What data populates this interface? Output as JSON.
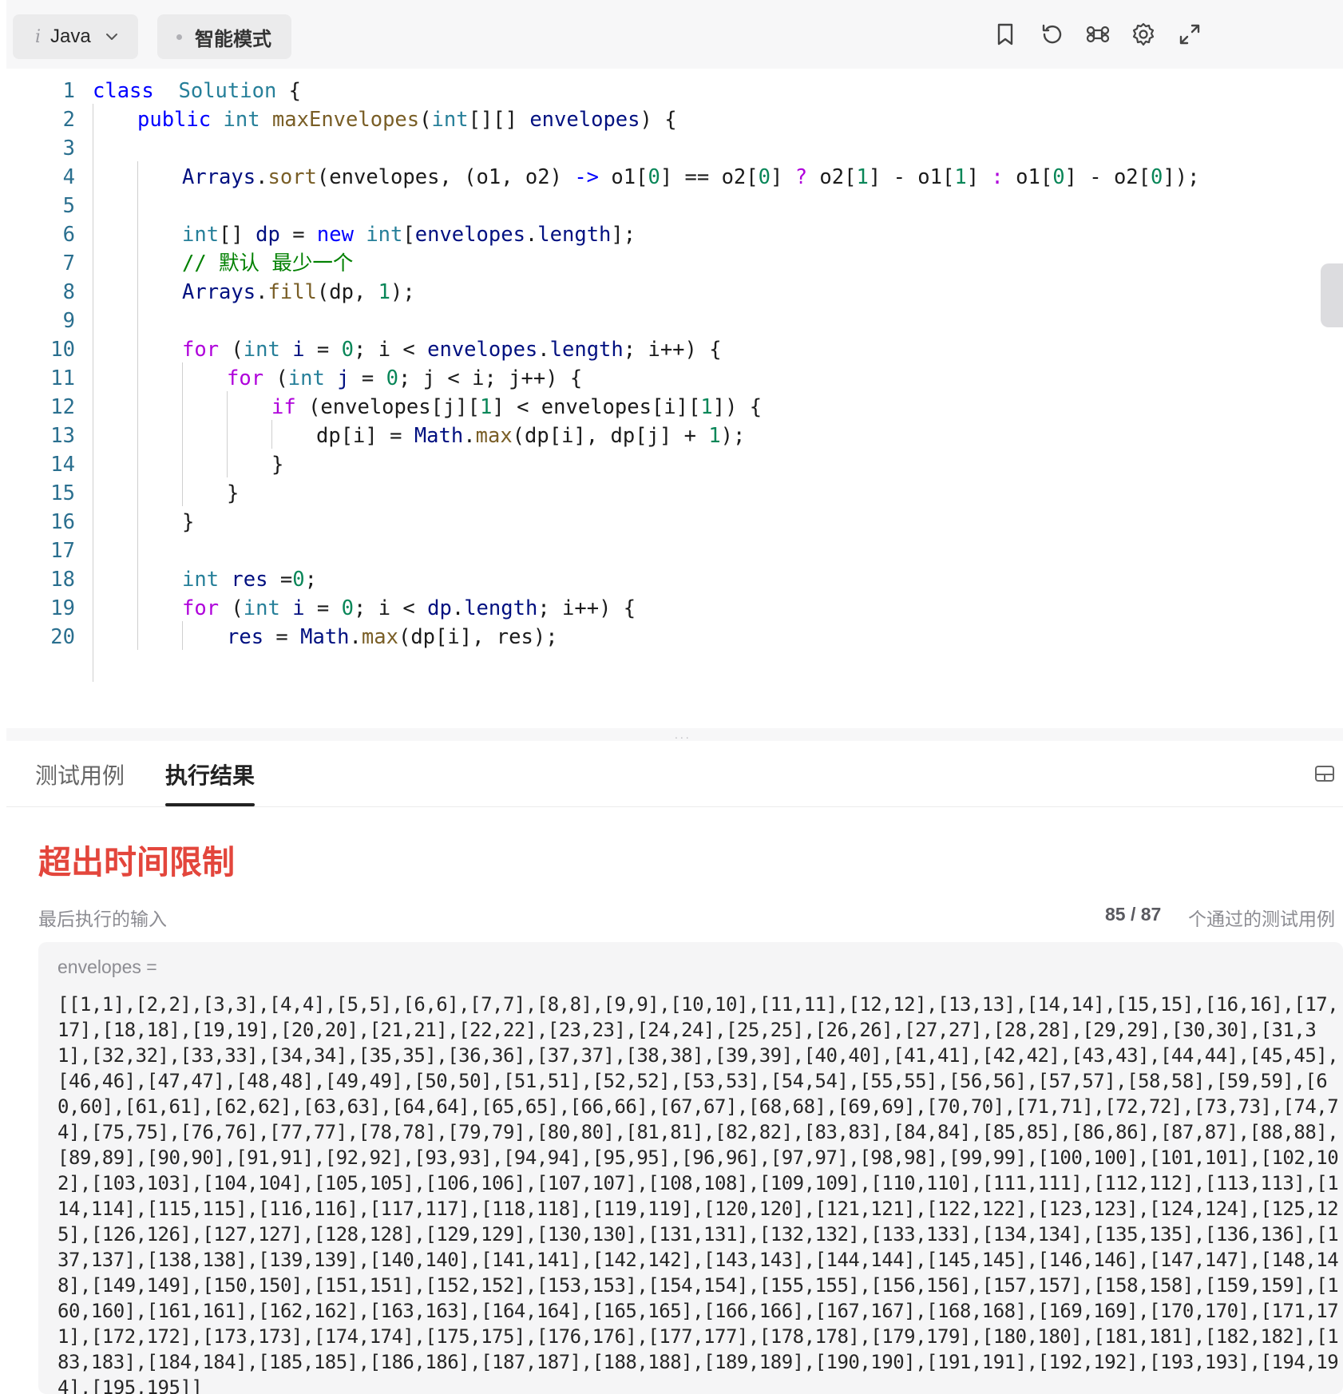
{
  "toolbar": {
    "language_icon": "i",
    "language": "Java",
    "mode_label": "智能模式",
    "icons": [
      "bookmark-icon",
      "reset-icon",
      "command-icon",
      "settings-icon",
      "fullscreen-icon"
    ]
  },
  "editor": {
    "lines": [
      {
        "n": "1",
        "indent": 0,
        "tokens": [
          [
            "kw",
            "class"
          ],
          [
            "",
            "  "
          ],
          [
            "ty",
            "Solution"
          ],
          [
            "",
            " {"
          ]
        ]
      },
      {
        "n": "2",
        "indent": 1,
        "tokens": [
          [
            "kw",
            "public"
          ],
          [
            "",
            " "
          ],
          [
            "ty",
            "int"
          ],
          [
            "",
            " "
          ],
          [
            "fn",
            "maxEnvelopes"
          ],
          [
            "",
            "("
          ],
          [
            "ty",
            "int"
          ],
          [
            "",
            "[][] "
          ],
          [
            "var",
            "envelopes"
          ],
          [
            "",
            ") {"
          ]
        ]
      },
      {
        "n": "3",
        "indent": 1,
        "tokens": []
      },
      {
        "n": "4",
        "indent": 2,
        "tokens": [
          [
            "var",
            "Arrays"
          ],
          [
            "",
            "."
          ],
          [
            "fn",
            "sort"
          ],
          [
            "",
            "("
          ],
          [
            "",
            "envelopes, (o1, o2) "
          ],
          [
            "kw",
            "->"
          ],
          [
            "",
            " o1["
          ],
          [
            "num",
            "0"
          ],
          [
            "",
            "] == o2["
          ],
          [
            "num",
            "0"
          ],
          [
            "",
            "] "
          ],
          [
            "kw2",
            "?"
          ],
          [
            "",
            " o2["
          ],
          [
            "num",
            "1"
          ],
          [
            "",
            "] - o1["
          ],
          [
            "num",
            "1"
          ],
          [
            "",
            "] "
          ],
          [
            "kw2",
            ":"
          ],
          [
            "",
            " o1["
          ],
          [
            "num",
            "0"
          ],
          [
            "",
            "] - o2["
          ],
          [
            "num",
            "0"
          ],
          [
            "",
            "]);"
          ]
        ]
      },
      {
        "n": "5",
        "indent": 2,
        "tokens": []
      },
      {
        "n": "6",
        "indent": 2,
        "tokens": [
          [
            "ty",
            "int"
          ],
          [
            "",
            "[] "
          ],
          [
            "var",
            "dp"
          ],
          [
            "",
            " = "
          ],
          [
            "kw",
            "new"
          ],
          [
            "",
            " "
          ],
          [
            "ty",
            "int"
          ],
          [
            "",
            "["
          ],
          [
            "var",
            "envelopes"
          ],
          [
            "",
            "."
          ],
          [
            "var",
            "length"
          ],
          [
            "",
            "];"
          ]
        ]
      },
      {
        "n": "7",
        "indent": 2,
        "tokens": [
          [
            "cm",
            "// 默认 最少一个"
          ]
        ]
      },
      {
        "n": "8",
        "indent": 2,
        "tokens": [
          [
            "var",
            "Arrays"
          ],
          [
            "",
            "."
          ],
          [
            "fn",
            "fill"
          ],
          [
            "",
            "(dp, "
          ],
          [
            "num",
            "1"
          ],
          [
            "",
            ");"
          ]
        ]
      },
      {
        "n": "9",
        "indent": 2,
        "tokens": []
      },
      {
        "n": "10",
        "indent": 2,
        "tokens": [
          [
            "kw2",
            "for"
          ],
          [
            "",
            " ("
          ],
          [
            "ty",
            "int"
          ],
          [
            "",
            " "
          ],
          [
            "var",
            "i"
          ],
          [
            "",
            " = "
          ],
          [
            "num",
            "0"
          ],
          [
            "",
            "; i < "
          ],
          [
            "var",
            "envelopes"
          ],
          [
            "",
            "."
          ],
          [
            "var",
            "length"
          ],
          [
            "",
            "; i++) {"
          ]
        ]
      },
      {
        "n": "11",
        "indent": 3,
        "tokens": [
          [
            "kw2",
            "for"
          ],
          [
            "",
            " ("
          ],
          [
            "ty",
            "int"
          ],
          [
            "",
            " "
          ],
          [
            "var",
            "j"
          ],
          [
            "",
            " = "
          ],
          [
            "num",
            "0"
          ],
          [
            "",
            "; j < i; j++) {"
          ]
        ]
      },
      {
        "n": "12",
        "indent": 4,
        "tokens": [
          [
            "kw2",
            "if"
          ],
          [
            "",
            " (envelopes[j]["
          ],
          [
            "num",
            "1"
          ],
          [
            "",
            "] < envelopes[i]["
          ],
          [
            "num",
            "1"
          ],
          [
            "",
            "]) {"
          ]
        ]
      },
      {
        "n": "13",
        "indent": 5,
        "tokens": [
          [
            "",
            "dp[i] = "
          ],
          [
            "var",
            "Math"
          ],
          [
            "",
            "."
          ],
          [
            "fn",
            "max"
          ],
          [
            "",
            "(dp[i], dp[j] + "
          ],
          [
            "num",
            "1"
          ],
          [
            "",
            ");"
          ]
        ]
      },
      {
        "n": "14",
        "indent": 4,
        "tokens": [
          [
            "",
            "}"
          ]
        ]
      },
      {
        "n": "15",
        "indent": 3,
        "tokens": [
          [
            "",
            "}"
          ]
        ]
      },
      {
        "n": "16",
        "indent": 2,
        "tokens": [
          [
            "",
            "}"
          ]
        ]
      },
      {
        "n": "17",
        "indent": 2,
        "tokens": []
      },
      {
        "n": "18",
        "indent": 2,
        "tokens": [
          [
            "ty",
            "int"
          ],
          [
            "",
            " "
          ],
          [
            "var",
            "res"
          ],
          [
            "",
            " ="
          ],
          [
            "num",
            "0"
          ],
          [
            "",
            ";"
          ]
        ]
      },
      {
        "n": "19",
        "indent": 2,
        "tokens": [
          [
            "kw2",
            "for"
          ],
          [
            "",
            " ("
          ],
          [
            "ty",
            "int"
          ],
          [
            "",
            " "
          ],
          [
            "var",
            "i"
          ],
          [
            "",
            " = "
          ],
          [
            "num",
            "0"
          ],
          [
            "",
            "; i < "
          ],
          [
            "var",
            "dp"
          ],
          [
            "",
            "."
          ],
          [
            "var",
            "length"
          ],
          [
            "",
            "; i++) {"
          ]
        ]
      },
      {
        "n": "20",
        "indent": 3,
        "tokens": [
          [
            "var",
            "res"
          ],
          [
            "",
            " = "
          ],
          [
            "var",
            "Math"
          ],
          [
            "",
            "."
          ],
          [
            "fn",
            "max"
          ],
          [
            "",
            "(dp[i], res);"
          ]
        ]
      }
    ]
  },
  "splitter": {
    "dots": "..."
  },
  "results": {
    "tabs": [
      {
        "label": "测试用例",
        "active": false
      },
      {
        "label": "执行结果",
        "active": true
      }
    ],
    "status": "超出时间限制",
    "last_input_label": "最后执行的输入",
    "passed": "85 / 87",
    "passed_label": "个通过的测试用例",
    "variable_label": "envelopes =",
    "envelopes_count": 195
  },
  "colors": {
    "keyword": "#0000ff",
    "control": "#af00db",
    "type": "#267f99",
    "function": "#795e26",
    "variable": "#001080",
    "number": "#098658",
    "comment": "#008000",
    "error": "#e3463c"
  }
}
